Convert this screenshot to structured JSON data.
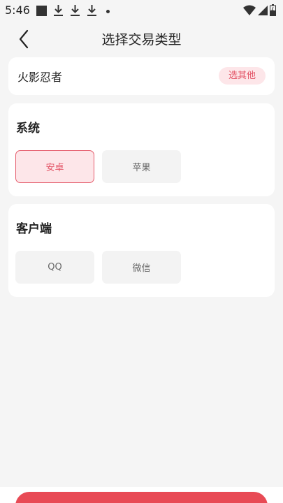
{
  "status_bar": {
    "time": "5:46",
    "icons": [
      "stop-square-icon",
      "download-icon",
      "download-icon",
      "download-icon",
      "dot-icon",
      "wifi-icon",
      "signal-icon",
      "battery-icon"
    ]
  },
  "header": {
    "title": "选择交易类型",
    "back_icon": "chevron-left-icon"
  },
  "game": {
    "name": "火影忍者",
    "choose_other_label": "选其他"
  },
  "sections": [
    {
      "title": "系统",
      "options": [
        {
          "label": "安卓",
          "selected": true
        },
        {
          "label": "苹果",
          "selected": false
        }
      ]
    },
    {
      "title": "客户端",
      "options": [
        {
          "label": "QQ",
          "selected": false
        },
        {
          "label": "微信",
          "selected": false
        }
      ]
    }
  ],
  "colors": {
    "accent": "#e35466",
    "accent_bg": "#fde6e9",
    "page_bg": "#f5f5f5",
    "option_bg": "#f3f3f3",
    "confirm_btn": "#e84a55"
  }
}
